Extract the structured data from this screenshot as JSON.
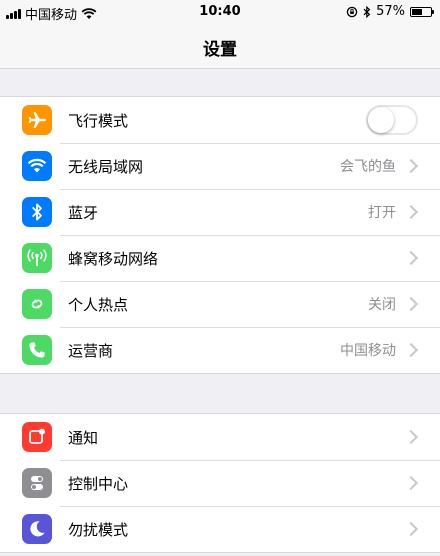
{
  "status_bar": {
    "carrier": "中国移动",
    "time": "10:40",
    "battery_percent": "57%",
    "battery_level": 0.57,
    "icons": [
      "signal-icon",
      "wifi-icon",
      "rotation-lock-icon",
      "bluetooth-icon",
      "battery-icon"
    ]
  },
  "nav": {
    "title": "设置"
  },
  "groups": [
    {
      "items": [
        {
          "label": "飞行模式",
          "icon": "airplane-icon",
          "color": "#ff9500",
          "toggle": false
        },
        {
          "label": "无线局域网",
          "icon": "wifi-icon",
          "color": "#007aff",
          "value": "会飞的鱼"
        },
        {
          "label": "蓝牙",
          "icon": "bluetooth-icon",
          "color": "#007aff",
          "value": "打开"
        },
        {
          "label": "蜂窝移动网络",
          "icon": "cellular-icon",
          "color": "#4cd964"
        },
        {
          "label": "个人热点",
          "icon": "hotspot-icon",
          "color": "#4cd964",
          "value": "关闭"
        },
        {
          "label": "运营商",
          "icon": "phone-icon",
          "color": "#4cd964",
          "value": "中国移动"
        }
      ]
    },
    {
      "items": [
        {
          "label": "通知",
          "icon": "notifications-icon",
          "color": "#ff3b30"
        },
        {
          "label": "控制中心",
          "icon": "control-center-icon",
          "color": "#8e8e93"
        },
        {
          "label": "勿扰模式",
          "icon": "moon-icon",
          "color": "#5856d6"
        }
      ]
    }
  ]
}
